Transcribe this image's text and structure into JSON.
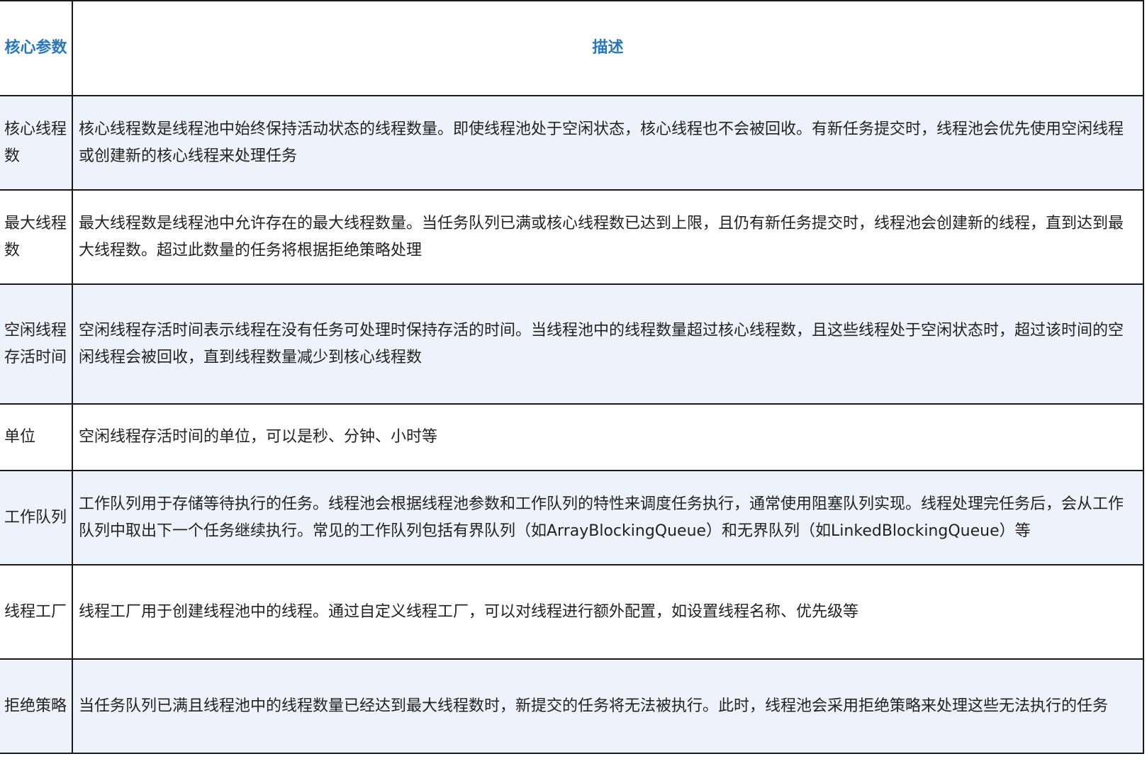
{
  "table": {
    "headers": {
      "name": "核心参数",
      "description": "描述"
    },
    "rows": [
      {
        "name": "核心线程数",
        "description": "核心线程数是线程池中始终保持活动状态的线程数量。即使线程池处于空闲状态，核心线程也不会被回收。有新任务提交时，线程池会优先使用空闲线程或创建新的核心线程来处理任务"
      },
      {
        "name": "最大线程数",
        "description": "最大线程数是线程池中允许存在的最大线程数量。当任务队列已满或核心线程数已达到上限，且仍有新任务提交时，线程池会创建新的线程，直到达到最大线程数。超过此数量的任务将根据拒绝策略处理"
      },
      {
        "name": "空闲线程存活时间",
        "description": "空闲线程存活时间表示线程在没有任务可处理时保持存活的时间。当线程池中的线程数量超过核心线程数，且这些线程处于空闲状态时，超过该时间的空闲线程会被回收，直到线程数量减少到核心线程数"
      },
      {
        "name": "单位",
        "description": "空闲线程存活时间的单位，可以是秒、分钟、小时等"
      },
      {
        "name": "工作队列",
        "description": "工作队列用于存储等待执行的任务。线程池会根据线程池参数和工作队列的特性来调度任务执行，通常使用阻塞队列实现。线程处理完任务后，会从工作队列中取出下一个任务继续执行。常见的工作队列包括有界队列（如ArrayBlockingQueue）和无界队列（如LinkedBlockingQueue）等"
      },
      {
        "name": "线程工厂",
        "description": "线程工厂用于创建线程池中的线程。通过自定义线程工厂，可以对线程进行额外配置，如设置线程名称、优先级等"
      },
      {
        "name": "拒绝策略",
        "description": "当任务队列已满且线程池中的线程数量已经达到最大线程数时，新提交的任务将无法被执行。此时，线程池会采用拒绝策略来处理这些无法执行的任务"
      }
    ]
  },
  "colors": {
    "header_text": "#2b78b9",
    "border": "#1a1a1a",
    "stripe": "#eef3fb",
    "body_text": "#222222"
  }
}
